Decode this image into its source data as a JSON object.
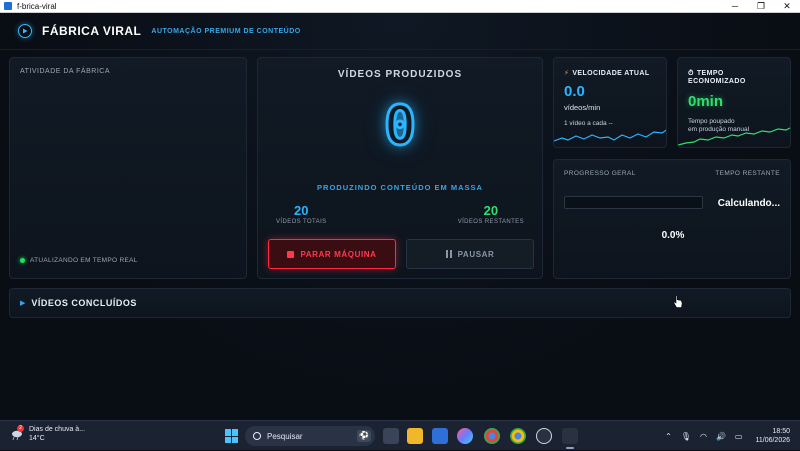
{
  "window": {
    "title": "f-brica-viral",
    "minimize": "─",
    "maximize": "❐",
    "close": "✕"
  },
  "header": {
    "brand": "FÁBRICA VIRAL",
    "tagline": "AUTOMAÇÃO PREMIUM DE CONTEÚDO"
  },
  "activity": {
    "title": "ATIVIDADE DA FÁBRICA",
    "live_label": "ATUALIZANDO EM TEMPO REAL"
  },
  "produced": {
    "title": "VÍDEOS PRODUZIDOS",
    "count": "0",
    "status": "PRODUZINDO CONTEÚDO EM MASSA",
    "total_value": "20",
    "total_label": "VÍDEOS TOTAIS",
    "remaining_value": "20",
    "remaining_label": "VÍDEOS RESTANTES",
    "stop_label": "PARAR MÁQUINA",
    "pause_label": "PAUSAR"
  },
  "speed": {
    "icon": "lightning-icon",
    "title": "VELOCIDADE ATUAL",
    "value": "0.0",
    "unit": "vídeos/min",
    "note": "1 vídeo a cada --"
  },
  "saved": {
    "icon": "stopwatch-icon",
    "title_line1": "TEMPO",
    "title_line2": "ECONOMIZADO",
    "value": "0min",
    "note_line1": "Tempo poupado",
    "note_line2": "em produção manual"
  },
  "progress": {
    "title": "PROGRESSO GERAL",
    "remaining_title": "TEMPO RESTANTE",
    "remaining_value": "Calculando...",
    "percent_label": "0.0%",
    "fraction": 0.0
  },
  "completed": {
    "label": "VÍDEOS CONCLUÍDOS"
  },
  "taskbar": {
    "weather_line1": "Dias de chuva à...",
    "weather_line2": "14°C",
    "weather_badge": "2",
    "search_placeholder": "Pesquisar",
    "time": "18:50",
    "date": "11/06/2026"
  },
  "colors": {
    "accent": "#2bb5ff",
    "success": "#2ee06b",
    "danger": "#ff2a3d"
  }
}
